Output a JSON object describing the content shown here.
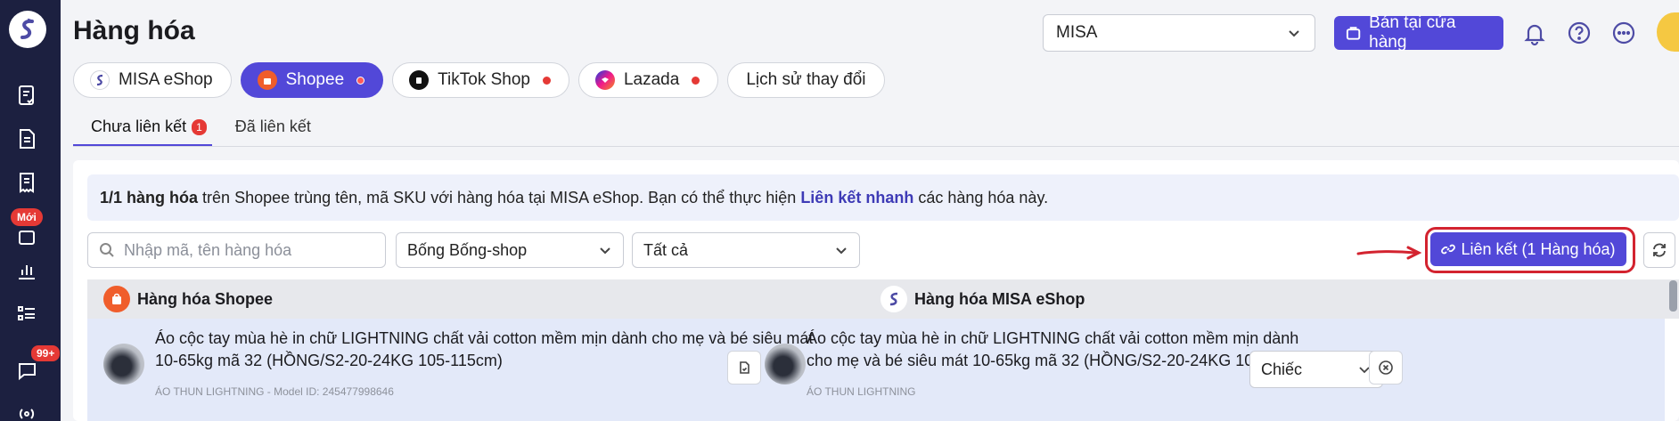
{
  "rail": {
    "new_badge": "Mới",
    "notif_count": "99+",
    "icons": [
      "app-logo-icon",
      "orders-check-icon",
      "document-icon",
      "receipt-icon",
      "grid-icon",
      "bar-chart-icon",
      "list-icon",
      "chat-icon",
      "broadcast-icon"
    ]
  },
  "header": {
    "title": "Hàng hóa",
    "store_select": "MISA",
    "sell_button": "Bán tại cửa hàng"
  },
  "channels": [
    {
      "label": "MISA eShop",
      "dot": false
    },
    {
      "label": "Shopee",
      "dot": true,
      "active": true
    },
    {
      "label": "TikTok Shop",
      "dot": true
    },
    {
      "label": "Lazada",
      "dot": true
    },
    {
      "label": "Lịch sử thay đổi",
      "dot": false
    }
  ],
  "sub_tabs": {
    "unlinked": "Chưa liên kết",
    "unlinked_count": "1",
    "linked": "Đã liên kết"
  },
  "info": {
    "count": "1/1 hàng hóa",
    "text1": "trên Shopee trùng tên, mã SKU với hàng hóa tại MISA eShop. Bạn có thể thực hiện",
    "link": "Liên kết nhanh",
    "text2": "các hàng hóa này."
  },
  "filters": {
    "search_placeholder": "Nhập mã, tên hàng hóa",
    "shop": "Bống Bống-shop",
    "status": "Tất cả"
  },
  "link_button": "Liên kết (1 Hàng hóa)",
  "table": {
    "col_shopee": "Hàng hóa Shopee",
    "col_misa": "Hàng hóa MISA eShop",
    "rows": [
      {
        "shopee_name_line1": "Áo cộc tay mùa hè in chữ LIGHTNING chất vải cotton mềm mịn dành cho mẹ và bé siêu mát",
        "shopee_name_line2": "10-65kg mã 32 (HỒNG/S2-20-24KG 105-115cm)",
        "shopee_sub": "ÁO THUN LIGHTNING - Model ID: 245477998646",
        "misa_name_line1": "Áo cộc tay mùa hè in chữ LIGHTNING chất vải cotton mềm mịn dành",
        "misa_name_line2": "cho mẹ và bé siêu mát 10-65kg mã 32 (HỒNG/S2-20-24KG 105-115cm)",
        "misa_sub": "ÁO THUN LIGHTNING",
        "unit": "Chiếc"
      }
    ]
  },
  "colors": {
    "primary": "#5248d8",
    "rail": "#1c2040",
    "alert": "#e53935",
    "shopee": "#f05d2b"
  }
}
